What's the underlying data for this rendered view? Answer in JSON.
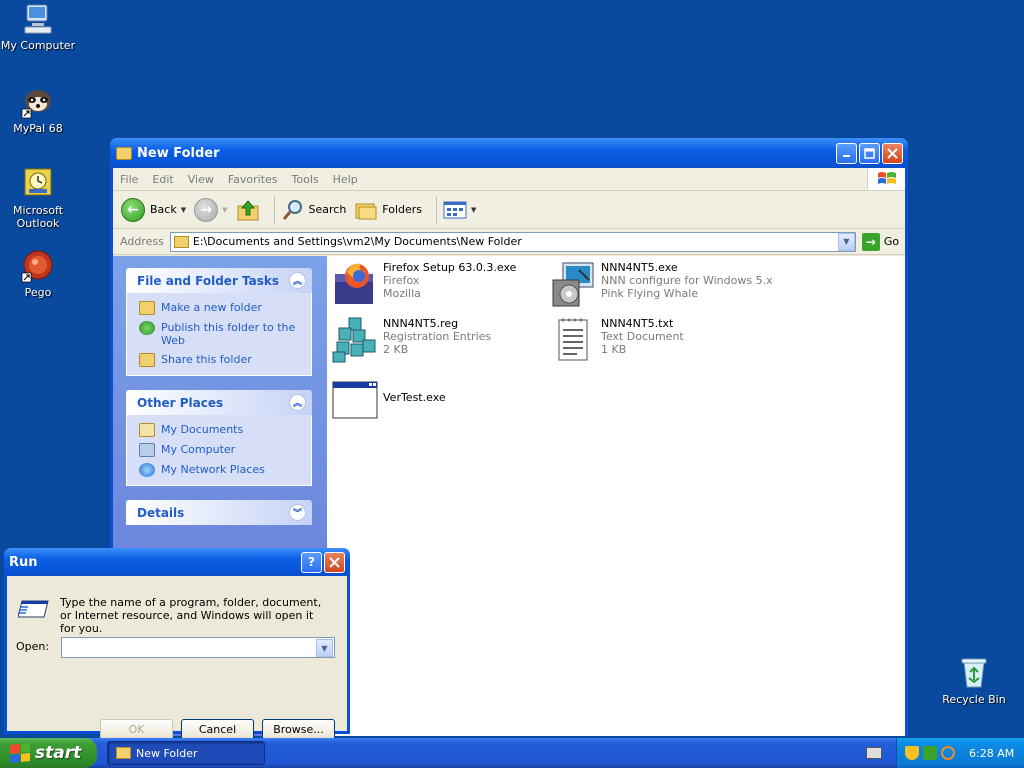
{
  "desktop": {
    "icons": [
      {
        "label": "My Computer"
      },
      {
        "label": "MyPal 68"
      },
      {
        "label_line1": "Microsoft",
        "label_line2": "Outlook"
      },
      {
        "label": "Pego"
      },
      {
        "label": "Recycle Bin"
      }
    ]
  },
  "explorer": {
    "title": "New Folder",
    "menu": [
      "File",
      "Edit",
      "View",
      "Favorites",
      "Tools",
      "Help"
    ],
    "toolbar": {
      "back": "Back",
      "search": "Search",
      "folders": "Folders"
    },
    "address": {
      "label": "Address",
      "path": "E:\\Documents and Settings\\vm2\\My Documents\\New Folder",
      "go": "Go"
    },
    "tasks_panel": {
      "title": "File and Folder Tasks",
      "items": [
        "Make a new folder",
        "Publish this folder to the Web",
        "Share this folder"
      ]
    },
    "places_panel": {
      "title": "Other Places",
      "items": [
        "My Documents",
        "My Computer",
        "My Network Places"
      ]
    },
    "details_panel": {
      "title": "Details"
    },
    "files": [
      {
        "name": "Firefox Setup 63.0.3.exe",
        "line2": "Firefox",
        "line3": "Mozilla"
      },
      {
        "name": "NNN4NT5.exe",
        "line2": "NNN configure for Windows 5.x",
        "line3": "Pink Flying Whale"
      },
      {
        "name": "NNN4NT5.reg",
        "line2": "Registration Entries",
        "line3": "2 KB"
      },
      {
        "name": "NNN4NT5.txt",
        "line2": "Text Document",
        "line3": "1 KB"
      },
      {
        "name": "VerTest.exe"
      }
    ]
  },
  "run_dialog": {
    "title": "Run",
    "help_label": "?",
    "close_label": "×",
    "description": "Type the name of a program, folder, document, or Internet resource, and Windows will open it for you.",
    "open_label": "Open:",
    "open_value": "",
    "ok": "OK",
    "cancel": "Cancel",
    "browse": "Browse..."
  },
  "taskbar": {
    "start": "start",
    "items": [
      {
        "label": "New Folder"
      }
    ],
    "clock": "6:28 AM"
  },
  "colors": {
    "desktop": "#0a4a9e",
    "title_blue": "#0754d8",
    "task_link": "#215dc6",
    "start_green": "#3c9e35"
  }
}
